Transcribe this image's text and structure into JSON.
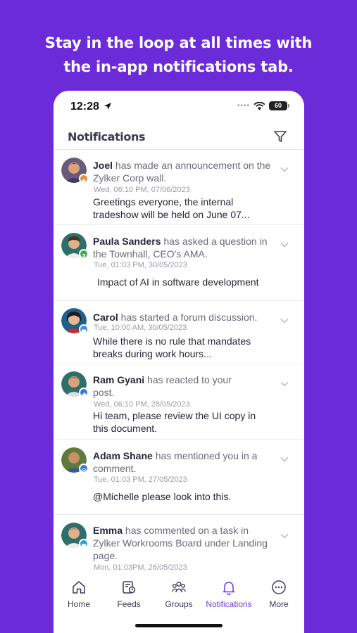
{
  "headline": {
    "line1": "Stay in the loop at all times with",
    "line2": "the in-app  notifications tab."
  },
  "status_bar": {
    "time": "12:28",
    "battery": "60",
    "icons": [
      "location-arrow-icon",
      "cellular-dots-icon",
      "wifi-icon",
      "battery-icon"
    ]
  },
  "header": {
    "title": "Notifications",
    "filter_icon": "filter-icon"
  },
  "notifications": [
    {
      "name": "Joel",
      "action": " has made an announcement on the Zylker Corp wall.",
      "timestamp": "Wed, 06:10 PM, 07/06/2023",
      "body": "Greetings everyone, the internal tradeshow will be held on June 07...",
      "badge_icon": "megaphone-icon",
      "badge_color": "#e8923a"
    },
    {
      "name": "Paula Sanders",
      "action": " has asked a question in the Townhall, CEO's AMA.",
      "timestamp": "Tue, 01:03 PM, 30/05/2023",
      "body": "Impact of AI in software development",
      "badge_icon": "question-icon",
      "badge_color": "#3fae49"
    },
    {
      "name": "Carol",
      "action": " has started a forum discussion.",
      "timestamp": "Tue, 10:00 AM, 30/05/2023",
      "body": "While there is no rule that mandates breaks during work hours...",
      "badge_icon": "forum-icon",
      "badge_color": "#3b8fe0"
    },
    {
      "name": "Ram Gyani",
      "action": " has reacted to your post.",
      "timestamp": "Wed, 06:10 PM, 28/05/2023",
      "body": "Hi team, please review the UI copy in this document.",
      "badge_icon": "thumbs-up-icon",
      "badge_color": "#2d7de0"
    },
    {
      "name": "Adam Shane",
      "action": " has mentioned you in a comment.",
      "timestamp": "Tue, 01:03 PM, 27/05/2023",
      "body": "@Michelle please look into this.",
      "badge_icon": "at-sign-icon",
      "badge_color": "#2d7de0"
    },
    {
      "name": "Emma",
      "action": " has commented on a task in Zylker Workrooms Board under Landing page.",
      "timestamp": "Mon, 01:03PM, 26/05/2023",
      "body": "",
      "badge_icon": "comment-icon",
      "badge_color": "#2d9ee0"
    }
  ],
  "nav": {
    "items": [
      {
        "label": "Home",
        "icon": "home-icon"
      },
      {
        "label": "Feeds",
        "icon": "feeds-icon"
      },
      {
        "label": "Groups",
        "icon": "groups-icon"
      },
      {
        "label": "Notifications",
        "icon": "bell-icon"
      },
      {
        "label": "More",
        "icon": "more-icon"
      }
    ],
    "active": "Notifications",
    "active_color": "#6b3fe0"
  },
  "colors": {
    "background": "#6b2bd9",
    "card": "#ffffff"
  }
}
